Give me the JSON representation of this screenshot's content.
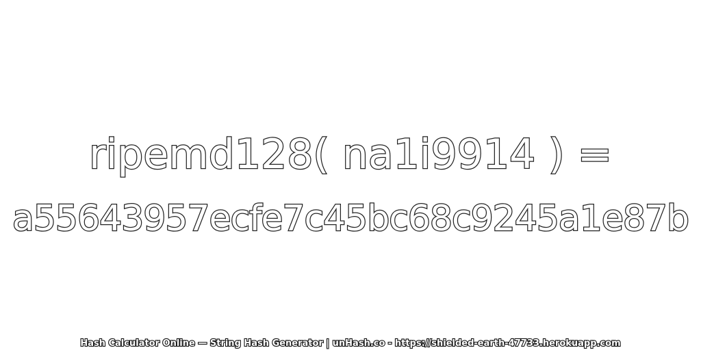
{
  "expression": "ripemd128( na1i9914 ) =",
  "digest": "a55643957ecfe7c45bc68c9245a1e87b",
  "footer": "Hash Calculator Online — String Hash Generator | unHash.co - https://shielded-earth-47733.herokuapp.com",
  "colors": {
    "background": "#ffffff",
    "text_fill": "#ffffff",
    "text_outline": "#222222"
  }
}
